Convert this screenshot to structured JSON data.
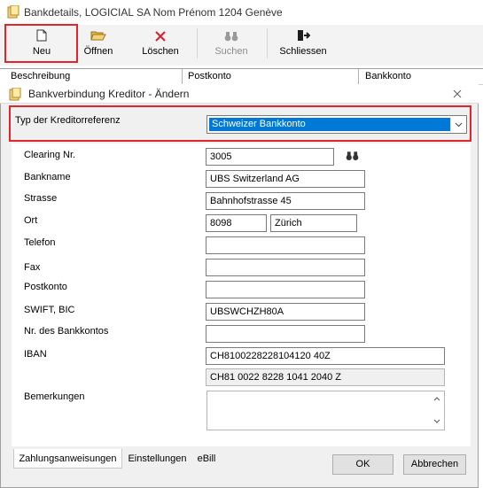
{
  "window": {
    "title": "Bankdetails, LOGICIAL SA Nom Prénom 1204 Genève"
  },
  "toolbar": {
    "buttons": [
      {
        "label": "Neu",
        "icon": "new-document-icon"
      },
      {
        "label": "Öffnen",
        "icon": "open-folder-icon"
      },
      {
        "label": "Löschen",
        "icon": "delete-x-icon"
      },
      {
        "label": "Suchen",
        "icon": "binoculars-icon"
      },
      {
        "label": "Schliessen",
        "icon": "exit-door-icon"
      }
    ]
  },
  "grid": {
    "columns": [
      "Beschreibung",
      "Postkonto",
      "Bankkonto"
    ]
  },
  "dialog": {
    "title": "Bankverbindung Kreditor - Ändern",
    "typ_label": "Typ der Kreditorreferenz",
    "typ_value": "Schweizer Bankkonto",
    "fields": {
      "clearing_label": "Clearing Nr.",
      "clearing_value": "3005",
      "bankname_label": "Bankname",
      "bankname_value": "UBS Switzerland AG",
      "strasse_label": "Strasse",
      "strasse_value": "Bahnhofstrasse 45",
      "ort_label": "Ort",
      "plz_value": "8098",
      "ort_value": "Zürich",
      "telefon_label": "Telefon",
      "telefon_value": "",
      "fax_label": "Fax",
      "fax_value": "",
      "postkonto_label": "Postkonto",
      "postkonto_value": "",
      "swift_label": "SWIFT, BIC",
      "swift_value": "UBSWCHZH80A",
      "nr_bankkonto_label": "Nr. des Bankkontos",
      "nr_bankkonto_value": "",
      "iban_label": "IBAN",
      "iban_value": "CH8100228228104120 40Z",
      "iban_formatted": "CH81 0022 8228 1041 2040 Z",
      "bemerkungen_label": "Bemerkungen",
      "bemerkungen_value": ""
    },
    "tabs": [
      "Zahlungsanweisungen",
      "Einstellungen",
      "eBill"
    ],
    "ok_label": "OK",
    "cancel_label": "Abbrechen"
  },
  "colors": {
    "highlight": "#e0262a",
    "selection": "#0078d7"
  }
}
